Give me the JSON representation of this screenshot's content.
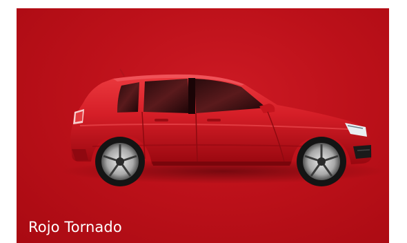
{
  "swatch": {
    "color_name": "Rojo Tornado",
    "background_color": "#bd111a",
    "car_color": "#d11d27",
    "icon": "red-hatchback-car-image"
  }
}
